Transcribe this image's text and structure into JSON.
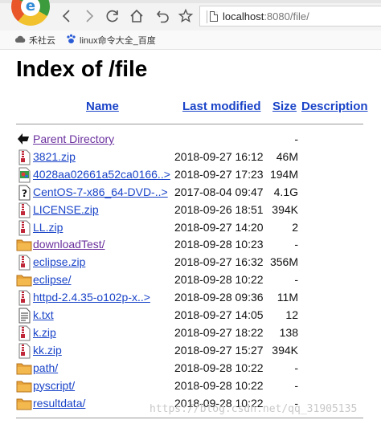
{
  "browser": {
    "url_host": "localhost",
    "url_rest": ":8080/file/"
  },
  "bookmarks": [
    {
      "label": "禾社云",
      "icon": "cloud-icon"
    },
    {
      "label": "linux命令大全_百度",
      "icon": "baidu-paw-icon"
    }
  ],
  "page": {
    "title": "Index of /file",
    "columns": {
      "name": "Name",
      "modified": "Last modified",
      "size": "Size",
      "description": "Description"
    }
  },
  "rows": [
    {
      "name": "Parent Directory",
      "date": "",
      "size": "-",
      "icon": "back-arrow-icon",
      "visited": true
    },
    {
      "name": "3821.zip",
      "date": "2018-09-27 16:12",
      "size": "46M",
      "icon": "archive-icon",
      "visited": false
    },
    {
      "name": "4028aa02661a52ca0166..>",
      "date": "2018-09-27 17:23",
      "size": "194M",
      "icon": "image-file-icon",
      "visited": false
    },
    {
      "name": "CentOS-7-x86_64-DVD-..>",
      "date": "2017-08-04 09:47",
      "size": "4.1G",
      "icon": "unknown-file-icon",
      "visited": false
    },
    {
      "name": "LICENSE.zip",
      "date": "2018-09-26 18:51",
      "size": "394K",
      "icon": "archive-icon",
      "visited": false
    },
    {
      "name": "LL.zip",
      "date": "2018-09-27 14:20",
      "size": "2",
      "icon": "archive-icon",
      "visited": false
    },
    {
      "name": "downloadTest/",
      "date": "2018-09-28 10:23",
      "size": "-",
      "icon": "folder-icon",
      "visited": true
    },
    {
      "name": "eclipse.zip",
      "date": "2018-09-27 16:32",
      "size": "356M",
      "icon": "archive-icon",
      "visited": false
    },
    {
      "name": "eclipse/",
      "date": "2018-09-28 10:22",
      "size": "-",
      "icon": "folder-icon",
      "visited": false
    },
    {
      "name": "httpd-2.4.35-o102p-x..>",
      "date": "2018-09-28 09:36",
      "size": "11M",
      "icon": "archive-icon",
      "visited": false
    },
    {
      "name": "k.txt",
      "date": "2018-09-27 14:05",
      "size": "12",
      "icon": "text-file-icon",
      "visited": false
    },
    {
      "name": "k.zip",
      "date": "2018-09-27 18:22",
      "size": "138",
      "icon": "archive-icon",
      "visited": false
    },
    {
      "name": "kk.zip",
      "date": "2018-09-27 15:27",
      "size": "394K",
      "icon": "archive-icon",
      "visited": false
    },
    {
      "name": "path/",
      "date": "2018-09-28 10:22",
      "size": "-",
      "icon": "folder-icon",
      "visited": false
    },
    {
      "name": "pyscript/",
      "date": "2018-09-28 10:22",
      "size": "-",
      "icon": "folder-icon",
      "visited": false
    },
    {
      "name": "resultdata/",
      "date": "2018-09-28 10:22",
      "size": "-",
      "icon": "folder-icon",
      "visited": false
    }
  ],
  "watermark": "https://blog.csdn.net/qq_31905135",
  "colors": {
    "link": "#1a44c8",
    "visited": "#6a2f9e",
    "folder": "#e8a33a"
  }
}
